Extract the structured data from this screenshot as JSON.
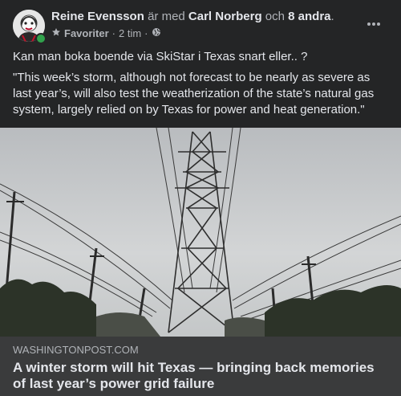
{
  "post": {
    "author": "Reine Evensson",
    "with_word": "är med",
    "tagged_person": "Carl Norberg",
    "and_word": "och",
    "others": "8 andra",
    "period": ".",
    "audience": "Favoriter",
    "time": "2 tim",
    "separator": "·",
    "text": "Kan man boka boende via SkiStar i Texas snart eller.. ?",
    "quote": "\"This week’s storm, although not forecast to be nearly as severe as last year’s, will also test the weatherization of the state’s natural gas system, largely relied on by Texas for power and heat generation.\""
  },
  "link": {
    "domain": "WASHINGTONPOST.COM",
    "headline": "A winter storm will hit Texas — bringing back memories of last year’s power grid failure"
  },
  "icons": {
    "audience": "star-icon",
    "privacy": "globe-icon",
    "more": "more-options-icon"
  },
  "colors": {
    "background": "#242526",
    "link_footer": "#3a3b3c",
    "primary_text": "#e4e6eb",
    "secondary_text": "#b0b3b8",
    "online": "#31a24c"
  }
}
